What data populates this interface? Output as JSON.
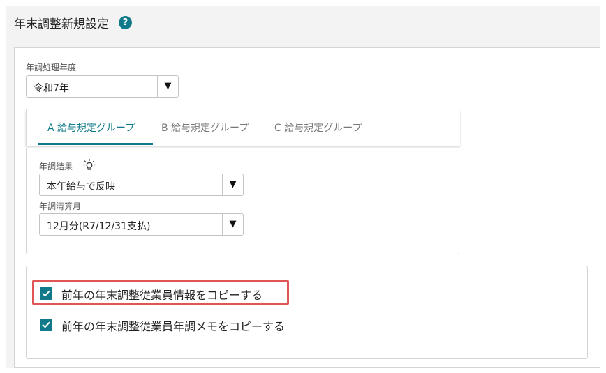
{
  "header": {
    "title": "年末調整新規設定",
    "help_icon": "?"
  },
  "year": {
    "label": "年調処理年度",
    "value": "令和7年",
    "arrow": "▼"
  },
  "tabs": [
    {
      "label": "A 給与規定グループ",
      "active": true
    },
    {
      "label": "B 給与規定グループ",
      "active": false
    },
    {
      "label": "C 給与規定グループ",
      "active": false
    }
  ],
  "group": {
    "result_label": "年調結果",
    "result_value": "本年給与で反映",
    "month_label": "年調清算月",
    "month_value": "12月分(R7/12/31支払)",
    "arrow": "▼"
  },
  "copy_options": [
    {
      "label": "前年の年末調整従業員情報をコピーする",
      "checked": true
    },
    {
      "label": "前年の年末調整従業員年調メモをコピーする",
      "checked": true
    }
  ],
  "colors": {
    "accent": "#107a8a",
    "highlight": "#e05555"
  }
}
